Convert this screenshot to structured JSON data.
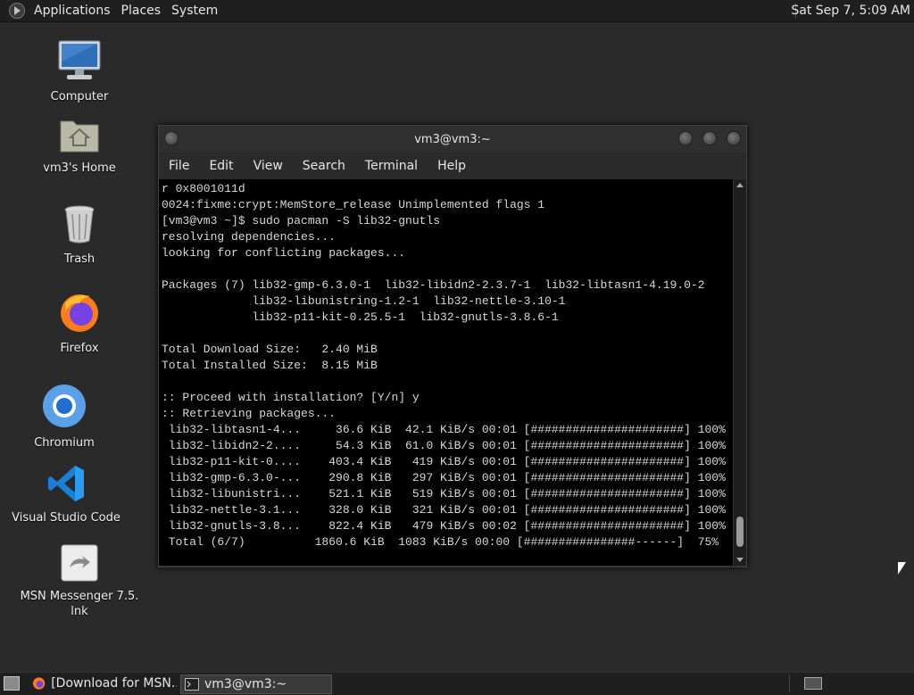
{
  "top_panel": {
    "menus": [
      "Applications",
      "Places",
      "System"
    ],
    "clock": "Sat Sep  7, 5:09 AM"
  },
  "desktop_icons": [
    {
      "label": "Computer",
      "icon": "computer-icon"
    },
    {
      "label": "vm3's Home",
      "icon": "home-folder-icon"
    },
    {
      "label": "Trash",
      "icon": "trash-icon"
    },
    {
      "label": "Firefox",
      "icon": "firefox-icon"
    },
    {
      "label": "Chromium",
      "icon": "chromium-icon"
    },
    {
      "label": "Visual Studio Code",
      "icon": "vscode-icon"
    },
    {
      "label": "MSN Messenger 7.5.\nlnk",
      "icon": "msn-messenger-icon"
    }
  ],
  "terminal": {
    "title": "vm3@vm3:~",
    "menus": [
      "File",
      "Edit",
      "View",
      "Search",
      "Terminal",
      "Help"
    ],
    "lines": [
      "r 0x8001011d",
      "0024:fixme:crypt:MemStore_release Unimplemented flags 1",
      "[vm3@vm3 ~]$ sudo pacman -S lib32-gnutls",
      "resolving dependencies...",
      "looking for conflicting packages...",
      "",
      "Packages (7) lib32-gmp-6.3.0-1  lib32-libidn2-2.3.7-1  lib32-libtasn1-4.19.0-2",
      "             lib32-libunistring-1.2-1  lib32-nettle-3.10-1",
      "             lib32-p11-kit-0.25.5-1  lib32-gnutls-3.8.6-1",
      "",
      "Total Download Size:   2.40 MiB",
      "Total Installed Size:  8.15 MiB",
      "",
      ":: Proceed with installation? [Y/n] y",
      ":: Retrieving packages...",
      " lib32-libtasn1-4...     36.6 KiB  42.1 KiB/s 00:01 [######################] 100%",
      " lib32-libidn2-2....     54.3 KiB  61.0 KiB/s 00:01 [######################] 100%",
      " lib32-p11-kit-0....    403.4 KiB   419 KiB/s 00:01 [######################] 100%",
      " lib32-gmp-6.3.0-...    290.8 KiB   297 KiB/s 00:01 [######################] 100%",
      " lib32-libunistri...    521.1 KiB   519 KiB/s 00:01 [######################] 100%",
      " lib32-nettle-3.1...    328.0 KiB   321 KiB/s 00:01 [######################] 100%",
      " lib32-gnutls-3.8...    822.4 KiB   479 KiB/s 00:02 [######################] 100%",
      " Total (6/7)          1860.6 KiB  1083 KiB/s 00:00 [################------]  75%"
    ]
  },
  "taskbar": {
    "tasks": [
      {
        "label": "[Download for MSN...",
        "icon": "firefox-icon"
      },
      {
        "label": "vm3@vm3:~",
        "icon": "terminal-icon"
      }
    ]
  },
  "colors": {
    "desktop_bg": "#2a2a2a",
    "panel_bg": "#1f1f1f",
    "terminal_bg": "#000000"
  }
}
